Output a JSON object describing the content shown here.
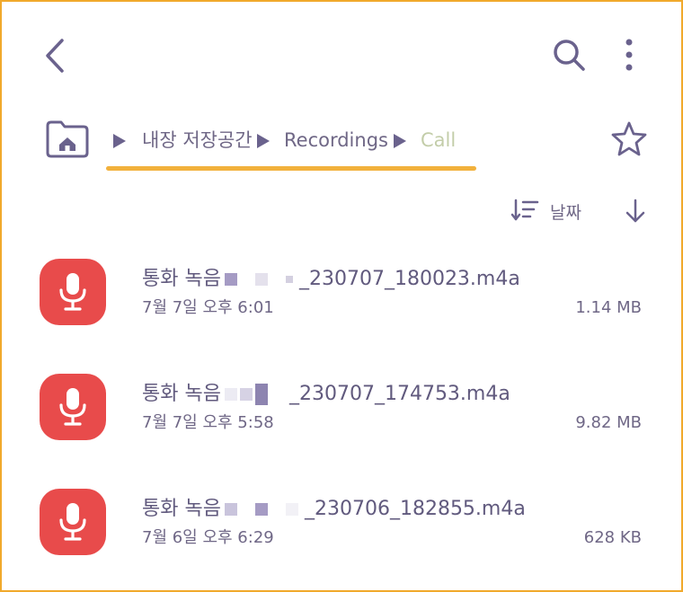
{
  "breadcrumbs": [
    {
      "label": "내장 저장공간"
    },
    {
      "label": "Recordings"
    },
    {
      "label": "Call"
    }
  ],
  "sort": {
    "label": "날짜"
  },
  "files": [
    {
      "prefix": "통화 녹음",
      "suffix": "_230707_180023.m4a",
      "date": "7월 7일 오후 6:01",
      "size": "1.14 MB"
    },
    {
      "prefix": "통화 녹음",
      "suffix": "_230707_174753.m4a",
      "date": "7월 7일 오후 5:58",
      "size": "9.82 MB"
    },
    {
      "prefix": "통화 녹음",
      "suffix": "_230706_182855.m4a",
      "date": "7월 6일 오후 6:29",
      "size": "628 KB"
    }
  ],
  "colors": {
    "accent": "#6a628d",
    "mic_tile": "#e84b4b",
    "current_crumb": "#c3cda9",
    "highlight": "#f2b13c"
  },
  "icons": {
    "back": "back-arrow-icon",
    "search": "search-icon",
    "more": "more-vertical-icon",
    "home": "home-folder-icon",
    "favorite": "star-icon",
    "sort": "sort-icon",
    "direction": "arrow-down-icon",
    "file": "microphone-icon"
  }
}
